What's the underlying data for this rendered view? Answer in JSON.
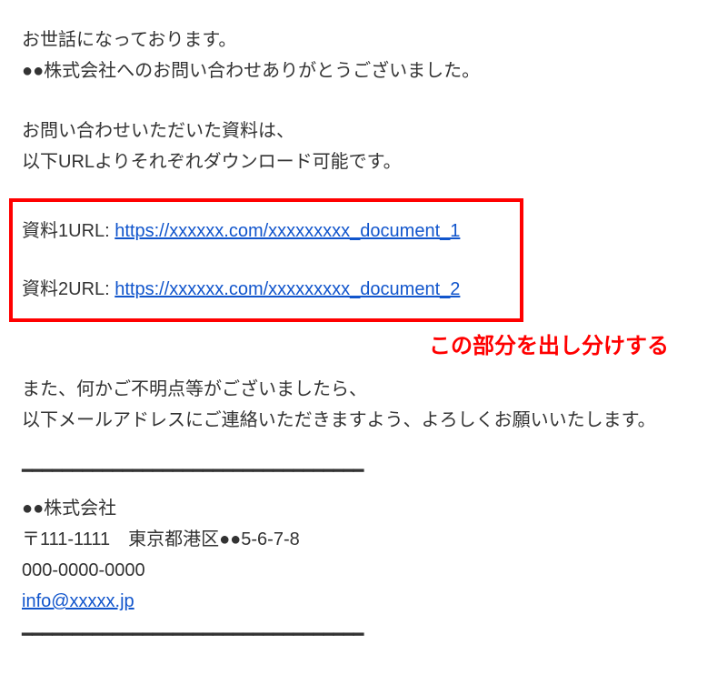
{
  "greeting": {
    "line1": "お世話になっております。",
    "line2": "●●株式会社へのお問い合わせありがとうございました。"
  },
  "intro": {
    "line1": "お問い合わせいただいた資料は、",
    "line2": "以下URLよりそれぞれダウンロード可能です。"
  },
  "documents": {
    "doc1": {
      "label": "資料1URL: ",
      "url": "https://xxxxxx.com/xxxxxxxxx_document_1"
    },
    "doc2": {
      "label": "資料2URL: ",
      "url": "https://xxxxxx.com/xxxxxxxxx_document_2"
    }
  },
  "callout": "この部分を出し分けする",
  "closing": {
    "line1": "また、何かご不明点等がございましたら、",
    "line2": "以下メールアドレスにご連絡いただきますよう、よろしくお願いいたします。"
  },
  "divider": "━━━━━━━━━━━━━━━━━━━━━━━━━━━━━━━━━━",
  "signature": {
    "company": "●●株式会社",
    "address": "〒111-1111　東京都港区●●5-6-7-8",
    "phone": "000-0000-0000",
    "email": "info@xxxxx.jp"
  }
}
